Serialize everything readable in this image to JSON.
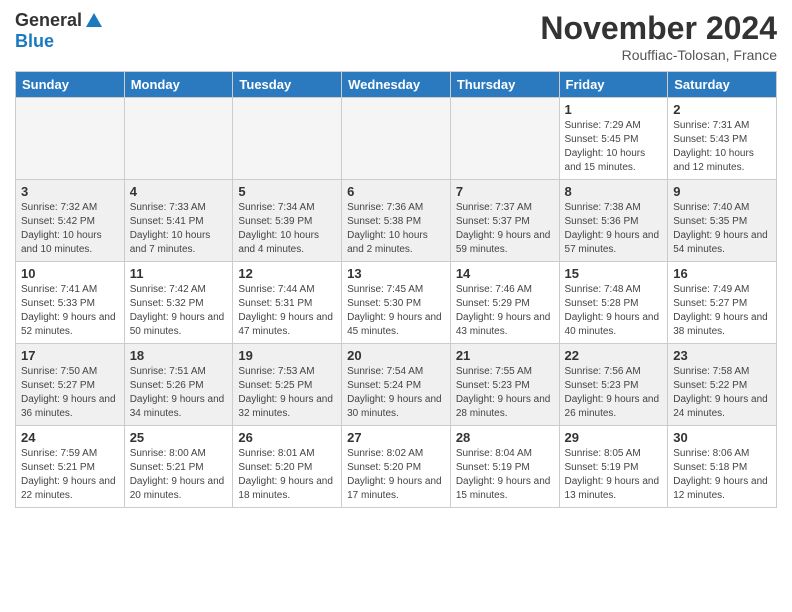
{
  "logo": {
    "general": "General",
    "blue": "Blue"
  },
  "title": "November 2024",
  "location": "Rouffiac-Tolosan, France",
  "headers": [
    "Sunday",
    "Monday",
    "Tuesday",
    "Wednesday",
    "Thursday",
    "Friday",
    "Saturday"
  ],
  "weeks": [
    [
      {
        "day": "",
        "info": ""
      },
      {
        "day": "",
        "info": ""
      },
      {
        "day": "",
        "info": ""
      },
      {
        "day": "",
        "info": ""
      },
      {
        "day": "",
        "info": ""
      },
      {
        "day": "1",
        "info": "Sunrise: 7:29 AM\nSunset: 5:45 PM\nDaylight: 10 hours and 15 minutes."
      },
      {
        "day": "2",
        "info": "Sunrise: 7:31 AM\nSunset: 5:43 PM\nDaylight: 10 hours and 12 minutes."
      }
    ],
    [
      {
        "day": "3",
        "info": "Sunrise: 7:32 AM\nSunset: 5:42 PM\nDaylight: 10 hours and 10 minutes."
      },
      {
        "day": "4",
        "info": "Sunrise: 7:33 AM\nSunset: 5:41 PM\nDaylight: 10 hours and 7 minutes."
      },
      {
        "day": "5",
        "info": "Sunrise: 7:34 AM\nSunset: 5:39 PM\nDaylight: 10 hours and 4 minutes."
      },
      {
        "day": "6",
        "info": "Sunrise: 7:36 AM\nSunset: 5:38 PM\nDaylight: 10 hours and 2 minutes."
      },
      {
        "day": "7",
        "info": "Sunrise: 7:37 AM\nSunset: 5:37 PM\nDaylight: 9 hours and 59 minutes."
      },
      {
        "day": "8",
        "info": "Sunrise: 7:38 AM\nSunset: 5:36 PM\nDaylight: 9 hours and 57 minutes."
      },
      {
        "day": "9",
        "info": "Sunrise: 7:40 AM\nSunset: 5:35 PM\nDaylight: 9 hours and 54 minutes."
      }
    ],
    [
      {
        "day": "10",
        "info": "Sunrise: 7:41 AM\nSunset: 5:33 PM\nDaylight: 9 hours and 52 minutes."
      },
      {
        "day": "11",
        "info": "Sunrise: 7:42 AM\nSunset: 5:32 PM\nDaylight: 9 hours and 50 minutes."
      },
      {
        "day": "12",
        "info": "Sunrise: 7:44 AM\nSunset: 5:31 PM\nDaylight: 9 hours and 47 minutes."
      },
      {
        "day": "13",
        "info": "Sunrise: 7:45 AM\nSunset: 5:30 PM\nDaylight: 9 hours and 45 minutes."
      },
      {
        "day": "14",
        "info": "Sunrise: 7:46 AM\nSunset: 5:29 PM\nDaylight: 9 hours and 43 minutes."
      },
      {
        "day": "15",
        "info": "Sunrise: 7:48 AM\nSunset: 5:28 PM\nDaylight: 9 hours and 40 minutes."
      },
      {
        "day": "16",
        "info": "Sunrise: 7:49 AM\nSunset: 5:27 PM\nDaylight: 9 hours and 38 minutes."
      }
    ],
    [
      {
        "day": "17",
        "info": "Sunrise: 7:50 AM\nSunset: 5:27 PM\nDaylight: 9 hours and 36 minutes."
      },
      {
        "day": "18",
        "info": "Sunrise: 7:51 AM\nSunset: 5:26 PM\nDaylight: 9 hours and 34 minutes."
      },
      {
        "day": "19",
        "info": "Sunrise: 7:53 AM\nSunset: 5:25 PM\nDaylight: 9 hours and 32 minutes."
      },
      {
        "day": "20",
        "info": "Sunrise: 7:54 AM\nSunset: 5:24 PM\nDaylight: 9 hours and 30 minutes."
      },
      {
        "day": "21",
        "info": "Sunrise: 7:55 AM\nSunset: 5:23 PM\nDaylight: 9 hours and 28 minutes."
      },
      {
        "day": "22",
        "info": "Sunrise: 7:56 AM\nSunset: 5:23 PM\nDaylight: 9 hours and 26 minutes."
      },
      {
        "day": "23",
        "info": "Sunrise: 7:58 AM\nSunset: 5:22 PM\nDaylight: 9 hours and 24 minutes."
      }
    ],
    [
      {
        "day": "24",
        "info": "Sunrise: 7:59 AM\nSunset: 5:21 PM\nDaylight: 9 hours and 22 minutes."
      },
      {
        "day": "25",
        "info": "Sunrise: 8:00 AM\nSunset: 5:21 PM\nDaylight: 9 hours and 20 minutes."
      },
      {
        "day": "26",
        "info": "Sunrise: 8:01 AM\nSunset: 5:20 PM\nDaylight: 9 hours and 18 minutes."
      },
      {
        "day": "27",
        "info": "Sunrise: 8:02 AM\nSunset: 5:20 PM\nDaylight: 9 hours and 17 minutes."
      },
      {
        "day": "28",
        "info": "Sunrise: 8:04 AM\nSunset: 5:19 PM\nDaylight: 9 hours and 15 minutes."
      },
      {
        "day": "29",
        "info": "Sunrise: 8:05 AM\nSunset: 5:19 PM\nDaylight: 9 hours and 13 minutes."
      },
      {
        "day": "30",
        "info": "Sunrise: 8:06 AM\nSunset: 5:18 PM\nDaylight: 9 hours and 12 minutes."
      }
    ]
  ]
}
